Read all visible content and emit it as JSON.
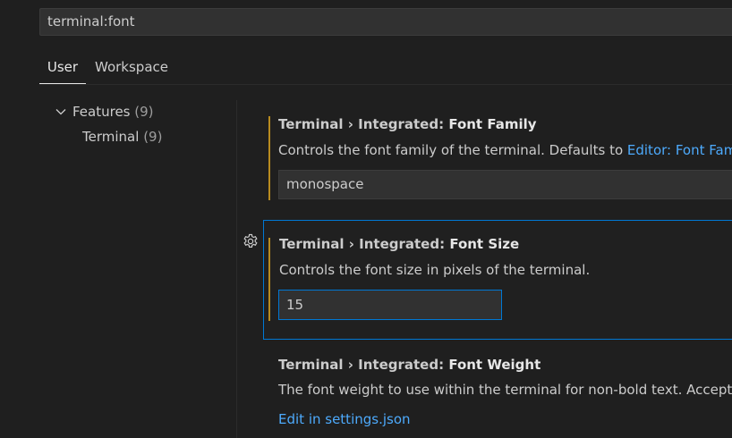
{
  "search": {
    "value": "terminal:font"
  },
  "tabs": [
    {
      "label": "User"
    },
    {
      "label": "Workspace"
    }
  ],
  "tree": {
    "features": {
      "label": "Features",
      "count": "(9)"
    },
    "terminal": {
      "label": "Terminal",
      "count": "(9)"
    }
  },
  "settings": [
    {
      "category": "Terminal › Integrated: ",
      "key": "Font Family",
      "desc_prefix": "Controls the font family of the terminal. Defaults to ",
      "desc_link": "Editor: Font Family",
      "desc_suffix": "'",
      "value": "monospace"
    },
    {
      "category": "Terminal › Integrated: ",
      "key": "Font Size",
      "desc": "Controls the font size in pixels of the terminal.",
      "value": "15"
    },
    {
      "category": "Terminal › Integrated: ",
      "key": "Font Weight",
      "desc": "The font weight to use within the terminal for non-bold text. Accepts \"n",
      "edit_link": "Edit in settings.json"
    }
  ],
  "colors": {
    "accent": "#0078d4",
    "modified_bar": "#b88b1f",
    "link": "#4daafc"
  }
}
